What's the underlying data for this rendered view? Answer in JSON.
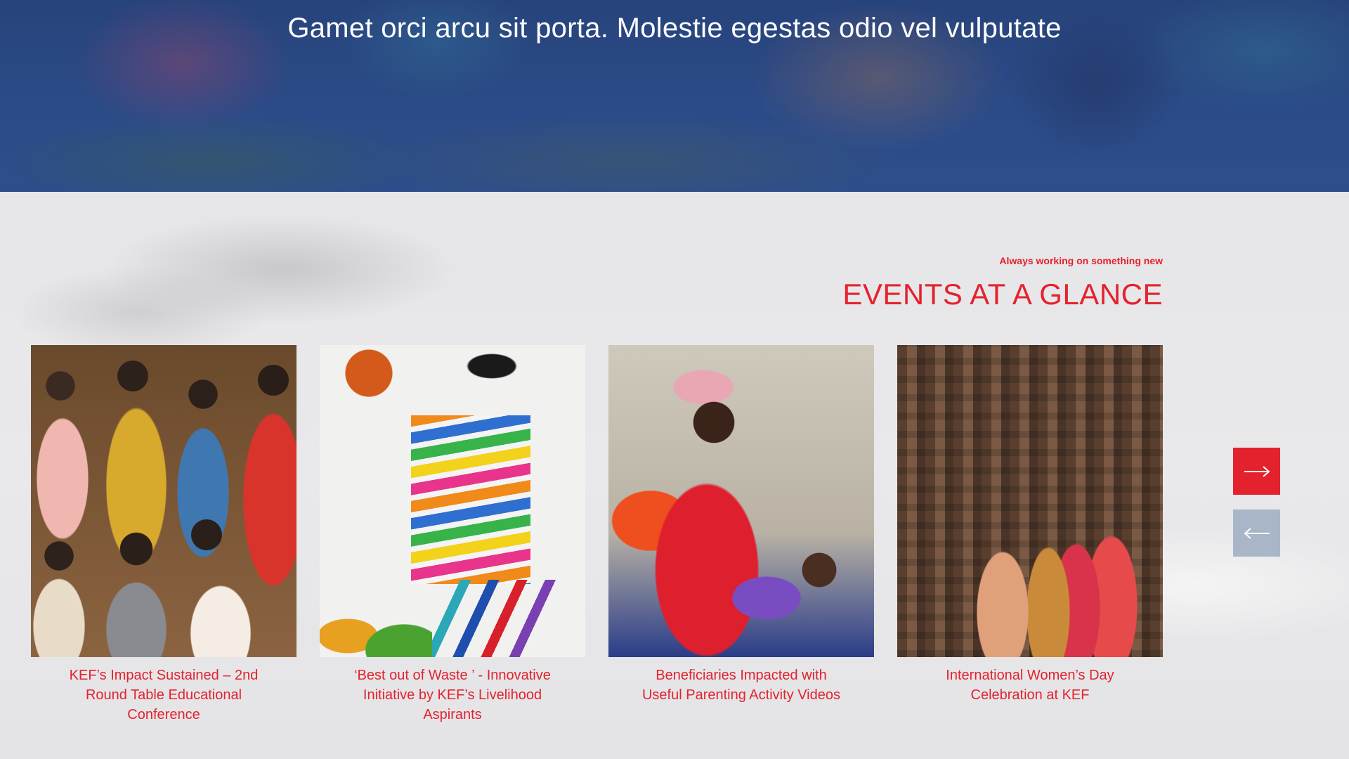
{
  "hero": {
    "title": "Gamet orci arcu sit porta. Molestie egestas odio vel vulputate"
  },
  "events": {
    "kicker": "Always working on something new",
    "title": "EVENTS AT A GLANCE",
    "cards": [
      {
        "caption": "KEF’s Impact Sustained – 2nd Round Table Educational Conference",
        "image": "group-photo-women"
      },
      {
        "caption": "‘Best out of Waste ’ - Innovative Initiative by KEF’s Livelihood Aspirants",
        "image": "art-supplies-photo"
      },
      {
        "caption": "Beneficiaries Impacted with Useful Parenting Activity Videos",
        "image": "mother-and-baby-photo"
      },
      {
        "caption": "International Women’s Day Celebration at KEF",
        "image": "temple-women-photo"
      }
    ]
  },
  "carousel": {
    "next_icon": "arrow-right-icon",
    "prev_icon": "arrow-left-icon",
    "next_color": "#e4222d",
    "prev_color": "#a8b6c8"
  },
  "colors": {
    "accent": "#e4222d",
    "hero_overlay": "#2f4f86"
  }
}
